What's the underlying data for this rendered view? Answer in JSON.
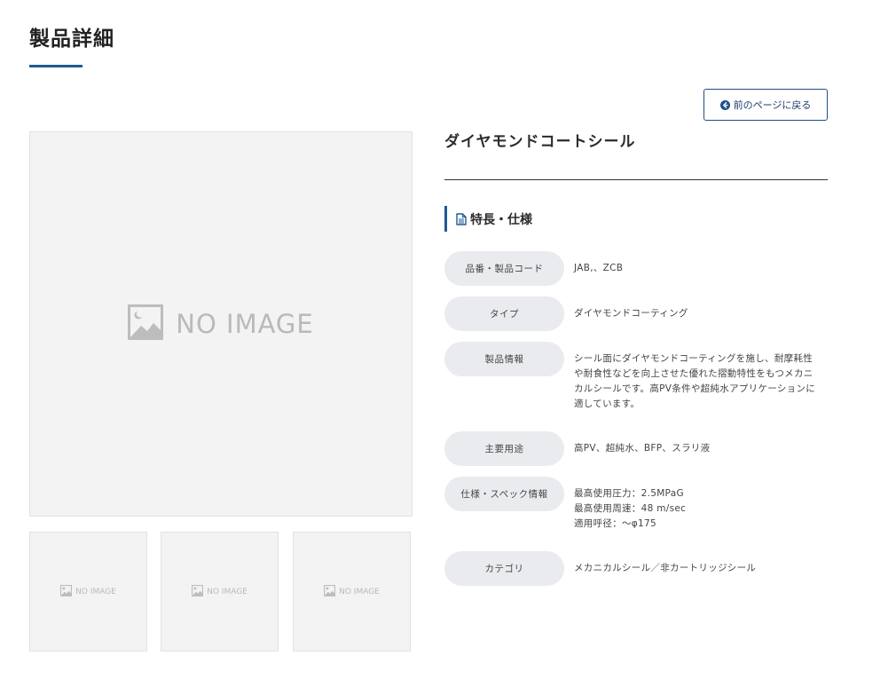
{
  "page": {
    "title": "製品詳細"
  },
  "back_button": {
    "label": "前のページに戻る",
    "icon": "arrow-circle-left-icon"
  },
  "gallery": {
    "main_placeholder": "NO IMAGE",
    "thumbnails": [
      {
        "placeholder": "NO IMAGE"
      },
      {
        "placeholder": "NO IMAGE"
      },
      {
        "placeholder": "NO IMAGE"
      }
    ]
  },
  "product": {
    "name": "ダイヤモンドコートシール",
    "section_heading": "特長・仕様",
    "section_icon": "document-icon",
    "specs": [
      {
        "label": "品番・製品コード",
        "lines": [
          "JAB,、ZCB"
        ]
      },
      {
        "label": "タイプ",
        "lines": [
          "ダイヤモンドコーティング"
        ]
      },
      {
        "label": "製品情報",
        "lines": [
          "シール面にダイヤモンドコーティングを施し、耐摩耗性",
          "や耐食性などを向上させた優れた摺動特性をもつメカニ",
          "カルシールです。高PV条件や超純水アプリケーションに",
          "適しています。"
        ]
      },
      {
        "label": "主要用途",
        "lines": [
          "高PV、超純水、BFP、スラリ液"
        ]
      },
      {
        "label": "仕様・スペック情報",
        "lines": [
          "最高使用圧力：2.5MPaG",
          "最高使用周速：48 m/sec",
          "適用呼径：～φ175"
        ]
      },
      {
        "label": "カテゴリ",
        "lines": [
          "メカニカルシール／非カートリッジシール"
        ]
      }
    ]
  },
  "colors": {
    "accent": "#1f5a96",
    "pill_bg": "#e9ebee",
    "placeholder_bg": "#f3f3f3",
    "placeholder_text": "#b9b9b9"
  }
}
